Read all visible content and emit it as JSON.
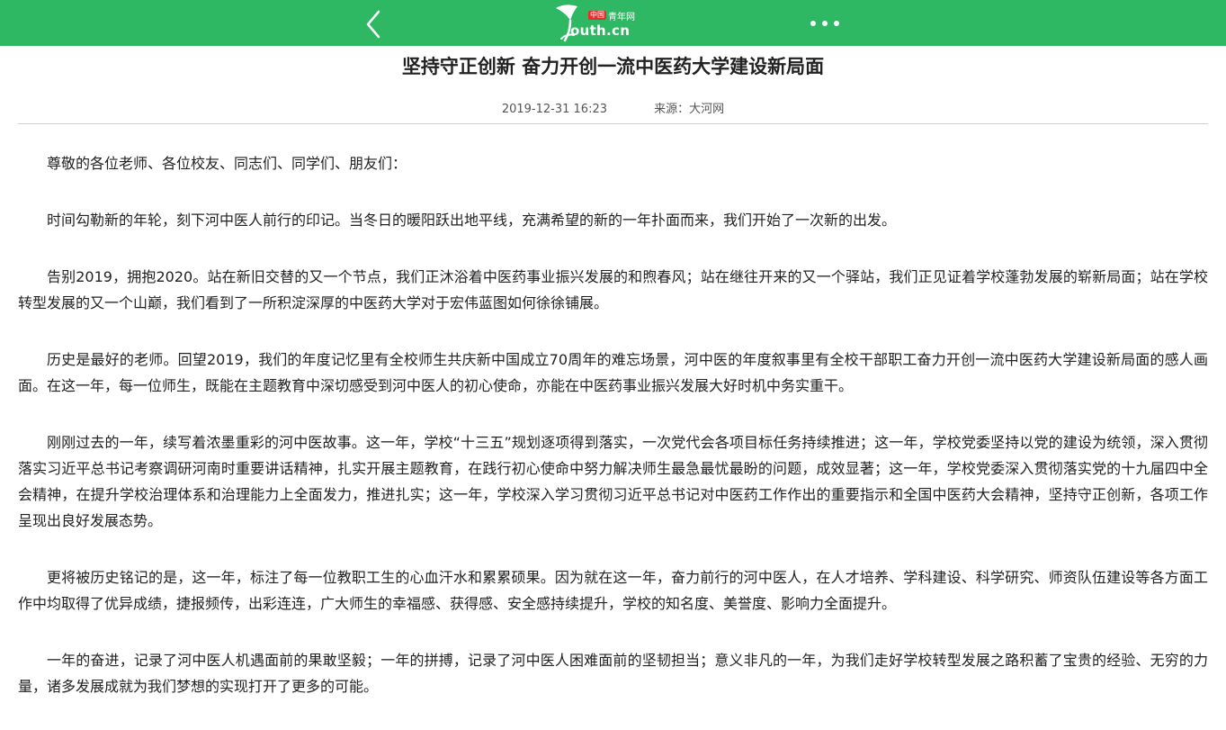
{
  "header": {
    "logo_badge_cn": "中国",
    "logo_badge_text": "青年网",
    "logo_text": "outh.cn",
    "bg_color": "#2fb863"
  },
  "icons": {
    "back": "chevron-left-icon",
    "more": "more-dots-icon"
  },
  "article": {
    "title": "坚持守正创新 奋力开创一流中医药大学建设新局面",
    "date": "2019-12-31 16:23",
    "source": "来源：大河网",
    "paragraphs": [
      "尊敬的各位老师、各位校友、同志们、同学们、朋友们：",
      "时间勾勒新的年轮，刻下河中医人前行的印记。当冬日的暖阳跃出地平线，充满希望的新的一年扑面而来，我们开始了一次新的出发。",
      "告别2019，拥抱2020。站在新旧交替的又一个节点，我们正沐浴着中医药事业振兴发展的和煦春风；站在继往开来的又一个驿站，我们正见证着学校蓬勃发展的崭新局面；站在学校转型发展的又一个山巅，我们看到了一所积淀深厚的中医药大学对于宏伟蓝图如何徐徐铺展。",
      "历史是最好的老师。回望2019，我们的年度记忆里有全校师生共庆新中国成立70周年的难忘场景，河中医的年度叙事里有全校干部职工奋力开创一流中医药大学建设新局面的感人画面。在这一年，每一位师生，既能在主题教育中深切感受到河中医人的初心使命，亦能在中医药事业振兴发展大好时机中务实重干。",
      "刚刚过去的一年，续写着浓墨重彩的河中医故事。这一年，学校“十三五”规划逐项得到落实，一次党代会各项目标任务持续推进；这一年，学校党委坚持以党的建设为统领，深入贯彻落实习近平总书记考察调研河南时重要讲话精神，扎实开展主题教育，在践行初心使命中努力解决师生最急最忧最盼的问题，成效显著；这一年，学校党委深入贯彻落实党的十九届四中全会精神，在提升学校治理体系和治理能力上全面发力，推进扎实；这一年，学校深入学习贯彻习近平总书记对中医药工作作出的重要指示和全国中医药大会精神，坚持守正创新，各项工作呈现出良好发展态势。",
      "更将被历史铭记的是，这一年，标注了每一位教职工生的心血汗水和累累硕果。因为就在这一年，奋力前行的河中医人，在人才培养、学科建设、科学研究、师资队伍建设等各方面工作中均取得了优异成绩，捷报频传，出彩连连，广大师生的幸福感、获得感、安全感持续提升，学校的知名度、美誉度、影响力全面提升。",
      "一年的奋进，记录了河中医人机遇面前的果敢坚毅；一年的拼搏，记录了河中医人困难面前的坚韧担当；意义非凡的一年，为我们走好学校转型发展之路积蓄了宝贵的经验、无穷的力量，诸多发展成就为我们梦想的实现打开了更多的可能。"
    ]
  }
}
